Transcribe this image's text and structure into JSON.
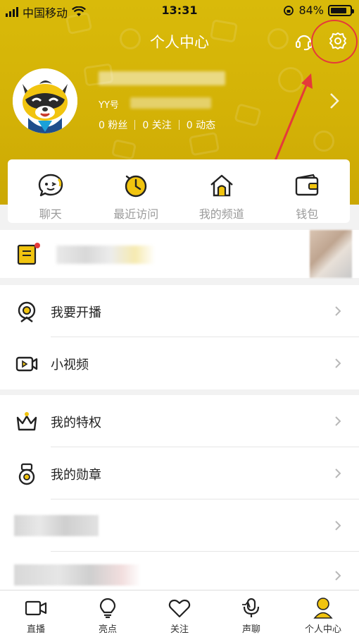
{
  "status_bar": {
    "carrier": "中国移动",
    "time": "13:31",
    "battery": "84%"
  },
  "header": {
    "title": "个人中心"
  },
  "profile": {
    "yy_label": "YY号",
    "fans": "0 粉丝",
    "follow": "0 关注",
    "posts": "0 动态"
  },
  "quick_actions": [
    {
      "label": "聊天",
      "icon": "chat-bubble-icon"
    },
    {
      "label": "最近访问",
      "icon": "clock-icon"
    },
    {
      "label": "我的频道",
      "icon": "house-icon"
    },
    {
      "label": "钱包",
      "icon": "wallet-icon"
    }
  ],
  "menu": {
    "section1": [
      {
        "label": "我要开播",
        "icon": "webcam-icon"
      },
      {
        "label": "小视频",
        "icon": "video-camera-icon"
      }
    ],
    "section2": [
      {
        "label": "我的特权",
        "icon": "crown-icon"
      },
      {
        "label": "我的勋章",
        "icon": "medal-icon"
      }
    ]
  },
  "tabs": [
    {
      "label": "直播",
      "icon": "tv-camera-icon"
    },
    {
      "label": "亮点",
      "icon": "bulb-icon"
    },
    {
      "label": "关注",
      "icon": "heart-icon"
    },
    {
      "label": "声聊",
      "icon": "microphone-icon"
    },
    {
      "label": "个人中心",
      "icon": "person-icon"
    }
  ],
  "colors": {
    "brand_yellow": "#d6b408",
    "accent_red": "#e53a3a"
  }
}
